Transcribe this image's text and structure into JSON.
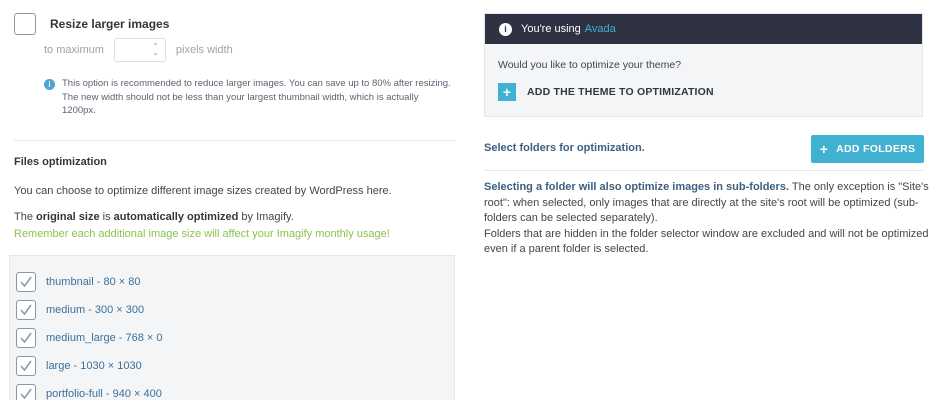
{
  "resize": {
    "label": "Resize larger images",
    "checked": false,
    "to_maximum": "to maximum",
    "max_value": "",
    "unit": "pixels width",
    "info": "This option is recommended to reduce larger images. You can save up to 80% after resizing. The new width should not be less than your largest thumbnail width, which is actually 1200px."
  },
  "files": {
    "title": "Files optimization",
    "description": "You can choose to optimize different image sizes created by WordPress here.",
    "original_prefix": "The ",
    "original_bold1": "original size",
    "original_mid": " is ",
    "original_bold2": "automatically optimized",
    "original_suffix": " by Imagify.",
    "warning": "Remember each additional image size will affect your Imagify monthly usage!",
    "sizes": [
      {
        "label": "thumbnail - 80 × 80",
        "checked": true
      },
      {
        "label": "medium - 300 × 300",
        "checked": true
      },
      {
        "label": "medium_large - 768 × 0",
        "checked": true
      },
      {
        "label": "large - 1030 × 1030",
        "checked": true
      },
      {
        "label": "portfolio-full - 940 × 400",
        "checked": true
      }
    ]
  },
  "theme": {
    "using_prefix": "You're using",
    "theme_name": "Avada",
    "question": "Would you like to optimize your theme?",
    "add_label": "ADD THE THEME TO OPTIMIZATION"
  },
  "folders": {
    "title": "Select folders for optimization.",
    "add_button": "ADD FOLDERS",
    "note_bold": "Selecting a folder will also optimize images in sub-folders.",
    "note_rest": " The only exception is \"Site's root\": when selected, only images that are directly at the site's root will be optimized (sub-folders can be selected separately).",
    "note_hidden": "Folders that are hidden in the folder selector window are excluded and will not be optimized even if a parent folder is selected."
  },
  "colors": {
    "accent": "#40b1d0",
    "dark_header": "#2e3243",
    "warning_green": "#8bc34a",
    "link_blue": "#3d6f9a"
  }
}
